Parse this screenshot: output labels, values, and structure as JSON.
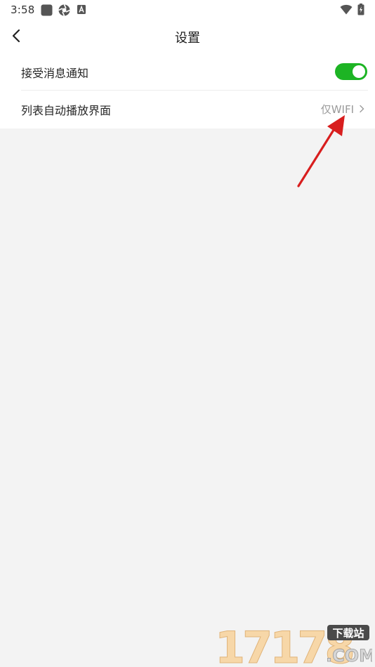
{
  "status_bar": {
    "time": "3:58"
  },
  "app_bar": {
    "title": "设置",
    "back_icon": "chevron-left-icon"
  },
  "settings": {
    "notifications": {
      "label": "接受消息通知",
      "enabled": true,
      "toggle_color": "#1db424"
    },
    "autoplay": {
      "label": "列表自动播放界面",
      "value": "仅WIFI"
    }
  },
  "annotation": {
    "arrow_color": "#d81e1e"
  },
  "watermark": {
    "numbers": "17178",
    "tag": "下载站",
    "domain": ".COM"
  }
}
